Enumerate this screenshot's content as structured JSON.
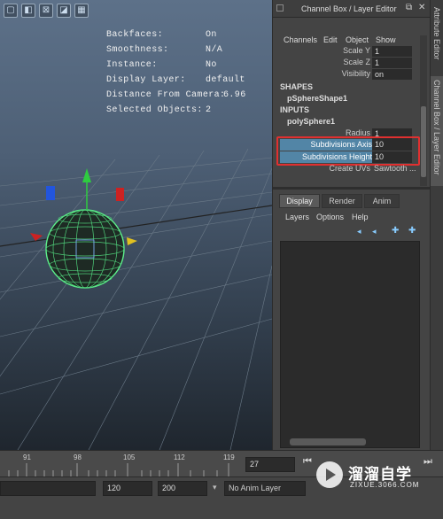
{
  "viewport": {
    "toolbar_icons": [
      "frame-icon",
      "camera-icon",
      "display-icon",
      "texture-icon",
      "grid-icon"
    ],
    "hud": [
      {
        "label": "Backfaces:",
        "value": "On"
      },
      {
        "label": "Smoothness:",
        "value": "N/A"
      },
      {
        "label": "Instance:",
        "value": "No"
      },
      {
        "label": "Display Layer:",
        "value": "default"
      },
      {
        "label": "Distance From Camera:",
        "value": "6.96"
      },
      {
        "label": "Selected Objects:",
        "value": "2"
      }
    ]
  },
  "channel_box": {
    "title": "Channel Box / Layer Editor",
    "menu": [
      "Channels",
      "Edit",
      "Object",
      "Show"
    ],
    "transform_attrs": [
      {
        "label": "Scale Y",
        "value": "1"
      },
      {
        "label": "Scale Z",
        "value": "1"
      },
      {
        "label": "Visibility",
        "value": "on"
      }
    ],
    "shapes_header": "SHAPES",
    "shape_name": "pSphereShape1",
    "inputs_header": "INPUTS",
    "input_name": "polySphere1",
    "input_attrs": [
      {
        "label": "Radius",
        "value": "1"
      },
      {
        "label": "Subdivisions Axis",
        "value": "10"
      },
      {
        "label": "Subdivisions Height",
        "value": "10"
      },
      {
        "label": "Create UVs",
        "value": "Sawtooth ..."
      }
    ],
    "highlight_color": "#e03030"
  },
  "layer_editor": {
    "tabs": [
      "Display",
      "Render",
      "Anim"
    ],
    "active_tab": "Display",
    "menu": [
      "Layers",
      "Options",
      "Help"
    ]
  },
  "side_tabs": {
    "attribute_editor": "Attribute Editor",
    "channel_box": "Channel Box / Layer Editor"
  },
  "timeline": {
    "ticks": [
      "91",
      "98",
      "105",
      "112",
      "119"
    ],
    "current_frame": "27"
  },
  "range": {
    "start_field": "120",
    "end_field": "200",
    "anim_layer": "No Anim Layer"
  },
  "watermark": {
    "title": "溜溜自学",
    "subtitle": "ZIXUE.3066.COM"
  }
}
